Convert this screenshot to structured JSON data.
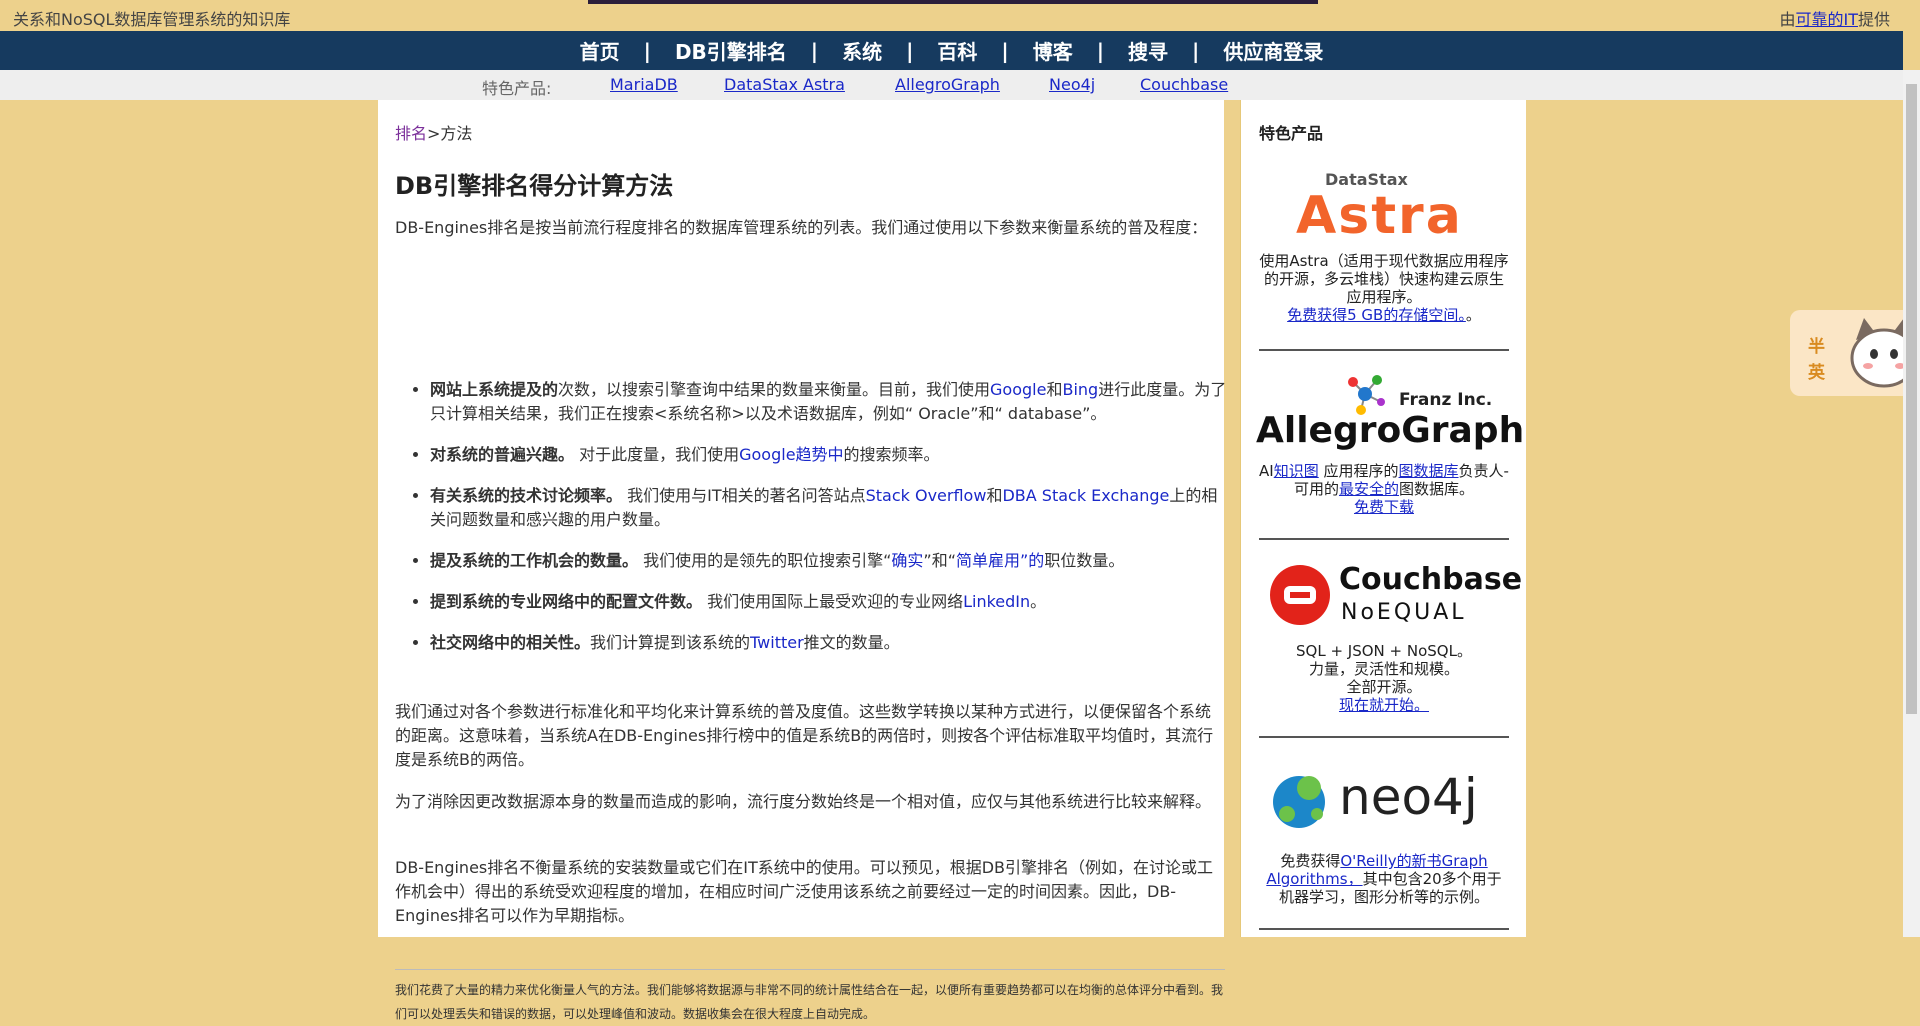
{
  "topbar": {
    "tagline": "关系和NoSQL数据库管理系统的知识库",
    "provider_prefix": "由",
    "provider_link": "可靠的IT",
    "provider_suffix": "提供"
  },
  "nav": {
    "items": [
      "首页",
      "DB引擎排名",
      "系统",
      "百科",
      "博客",
      "搜寻",
      "供应商登录"
    ],
    "separator": "|"
  },
  "featured_bar": {
    "label": "特色产品:",
    "links": [
      "MariaDB ",
      "DataStax Astra ",
      "AllegroGraph ",
      "Neo4j ",
      "Couchbase"
    ]
  },
  "breadcrumb": {
    "link": "排名",
    "sep": ">",
    "current": "方法"
  },
  "main": {
    "title": "DB引擎排名得分计算方法",
    "intro": "DB-Engines排名是按当前流行程度排名的数据库管理系统的列表。我们通过使用以下参数来衡量系统的普及程度：",
    "bullets": [
      {
        "bold": "网站上系统提及的",
        "t1": "次数，以搜索引擎查询中结果的数量来衡量。目前，我们使用",
        "a1": "Google",
        "t2": "和",
        "a2": "Bing",
        "t3": "进行此度量。为了只计算相关结果，我们正在搜索<系统名称>以及术语数据库，例如“ Oracle”和“ database”。"
      },
      {
        "bold": "对系统的普遍兴趣。",
        "t1": " 对于此度量，我们使用",
        "a1": "Google趋势中",
        "t2": "的搜索频率。"
      },
      {
        "bold": "有关系统的技术讨论频率。",
        "t1": " 我们使用与IT相关的著名问答站点",
        "a1": "Stack Overflow",
        "t2": "和",
        "a2": "DBA Stack Exchange",
        "t3": "上的相关问题数量和感兴趣的用户数量。"
      },
      {
        "bold": "提及系统的工作机会的数量。",
        "t1": " 我们使用的是领先的职位搜索引擎“",
        "a1": "确实",
        "t2": "”和“",
        "a2": "简单雇用”的",
        "t3": "职位数量。"
      },
      {
        "bold": "提到系统的专业网络中的配置文件数。",
        "t1": " 我们使用国际上最受欢迎的专业网络",
        "a1": "LinkedIn",
        "t2": "。"
      },
      {
        "bold": "社交网络中的相关性。",
        "t1": "我们计算提到该系统的",
        "a1": "Twitter",
        "t2": "推文的数量。"
      }
    ],
    "para2": "我们通过对各个参数进行标准化和平均化来计算系统的普及度值。这些数学转换以某种方式进行，以便保留各个系统的距离。这意味着，当系统A在DB-Engines排行榜中的值是系统B的两倍时，则按各个评估标准取平均值时，其流行度是系统B的两倍。",
    "para3": "为了消除因更改数据源本身的数量而造成的影响，流行度分数始终是一个相对值，应仅与其他系统进行比较来解释。",
    "para4": "DB-Engines排名不衡量系统的安装数量或它们在IT系统中的使用。可以预见，根据DB引擎排名（例如，在讨论或工作机会中）得出的系统受欢迎程度的增加，在相应时间广泛使用该系统之前要经过一定的时间因素。因此，DB-Engines排名可以作为早期指标。",
    "footnote": "我们花费了大量的精力来优化衡量人气的方法。我们能够将数据源与非常不同的统计属性结合在一起，以便所有重要趋势都可以在均衡的总体评分中看到。我们可以处理丢失和错误的数据，可以处理峰值和波动。数据收集会在很大程度上自动完成。"
  },
  "sidebar": {
    "title": "特色产品",
    "ads": [
      {
        "logo_top": "DataStax",
        "logo_main": "Astra",
        "text1": "使用Astra（适用于现代数据应用程序的开源，多云堆栈）快速构建云原生应用程序。",
        "link": "免费获得5 GB的存储空间。",
        "text2": "。"
      },
      {
        "logo_top": "Franz Inc.",
        "logo_main": "AllegroGraph",
        "t1": "AI",
        "a1": "知识图",
        "t2": " 应用程序的",
        "a2": "图数据库",
        "t3": "负责人-可用的",
        "a3": "最安全的",
        "t4": "图数据库。",
        "link": "免费下载"
      },
      {
        "logo_main": "Couchbase",
        "logo_sub": "NoEQUAL",
        "text1": "SQL + JSON + NoSQL。",
        "text2": "力量，灵活性和规模。",
        "text3": "全部开源。",
        "link": "现在就开始。"
      },
      {
        "logo_main": "neo4j",
        "t1": "免费获得",
        "a1": "O'Reilly的新书Graph Algorithms，",
        "t2": "其中包含20多个用于机器学习，图形分析等的示例。"
      }
    ]
  },
  "mascot": {
    "t1": "半",
    "t2": "英"
  },
  "colors": {
    "nav_bg": "#163a5f",
    "page_bg": "#edd18c",
    "link": "#1a28c8",
    "astra_orange": "#f2642b",
    "couchbase_red": "#e2231a",
    "neo4j_blue": "#1c87c9",
    "neo4j_green": "#6cc24a"
  }
}
